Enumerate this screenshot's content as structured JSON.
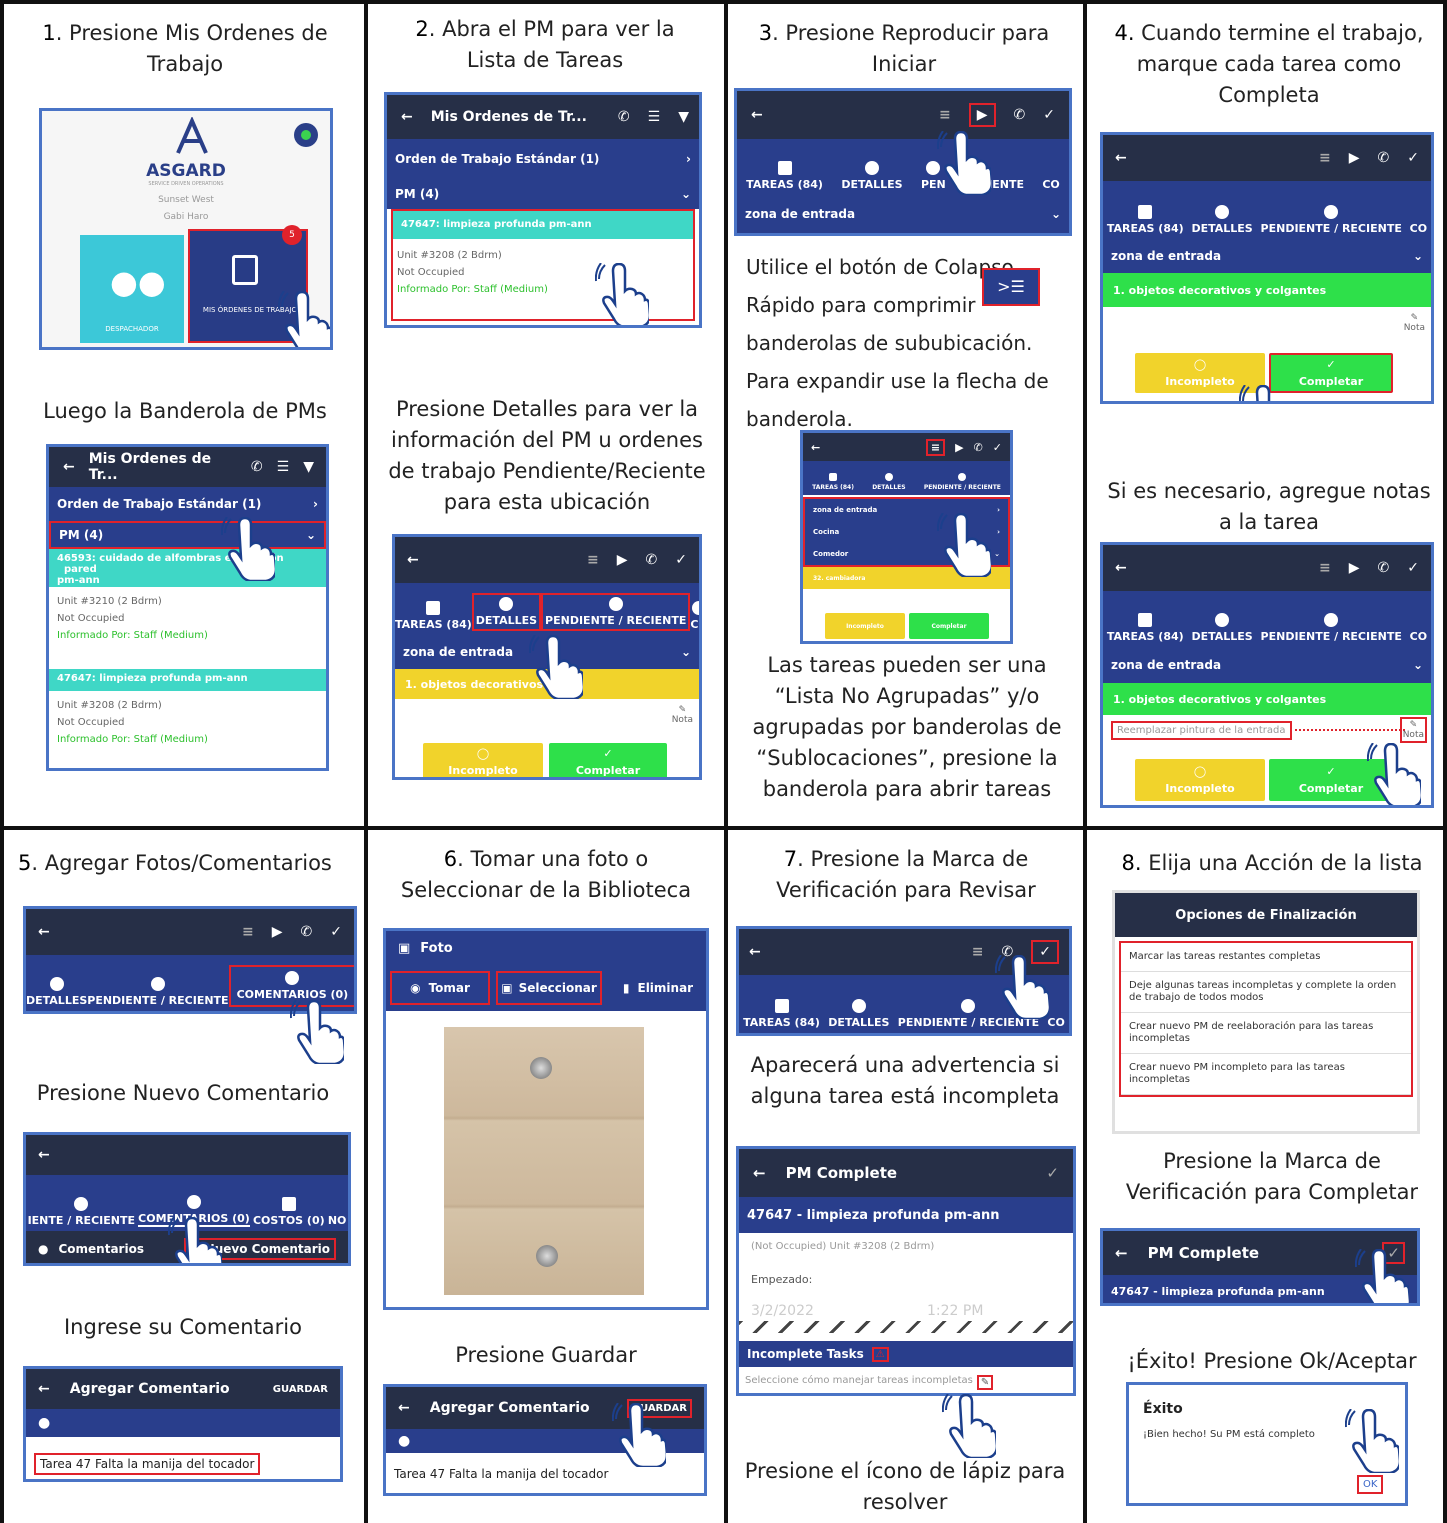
{
  "step1": {
    "num": "1",
    "text": ". Presione Mis Ordenes de Trabajo",
    "sub": "Luego la Banderola de PMs",
    "logo": "ASGARD",
    "logo_sub": "SERVICE DRIVEN OPERATIONS",
    "location": "Sunset West",
    "user": "Gabi Haro",
    "dispatcher": "DESPACHADOR",
    "my_orders": "MIS ÓRDENES DE TRABAJO",
    "badge": "5"
  },
  "list": {
    "title": "Mis Ordenes de Tr...",
    "std": "Orden de Trabajo Estándar (1)",
    "pm": "PM (4)",
    "wo1": "46593: cuidado de alfombras extracción",
    "wo1b": "pared",
    "wo1c": "pm-ann",
    "unit1": "Unit #3210 (2 Bdrm)",
    "occ": "Not Occupied",
    "informed": "Informado Por: Staff  (Medium)",
    "wo2": "47647: limpieza profunda pm-ann",
    "unit2": "Unit #3208 (2 Bdrm)"
  },
  "step2": {
    "num": "2",
    "text": ". Abra el PM para ver la Lista de Tareas",
    "sub": "Presione Detalles para ver la información del PM u ordenes de trabajo Pendiente/Reciente para esta ubicación"
  },
  "tabs": {
    "tareas": "TAREAS (84)",
    "detalles": "DETALLES",
    "pendiente": "PENDIENTE / RECIENTE",
    "co": "CO",
    "comentarios": "COMENTARIOS (0)",
    "costos": "COSTOS (0)",
    "pend_short": "IENTE / RECIENTE",
    "no": "NO",
    "pen": "PEN",
    "reciente": "RECIENTE"
  },
  "task": {
    "zona": "zona de entrada",
    "obj": "1. objetos decorativos y colgantes",
    "obj_short": "1. objetos decorativos y co",
    "nota": "Nota",
    "incomp": "Incompleto",
    "comp": "Completar",
    "cocina": "Cocina",
    "comedor": "Comedor",
    "cambiadora": "32. cambiadora",
    "reemplazar": "Reemplazar pintura de la entrada"
  },
  "step3": {
    "num": "3",
    "text": ". Presione Reproducir para Iniciar",
    "collapse": "Utilice el botón de Colapso Rápido para comprimir banderolas de sububicación. Para expandir use la flecha de banderola.",
    "collapse_icon": ">☰",
    "sub": "Las tareas pueden ser una “Lista No Agrupadas” y/o agrupadas por banderolas de “Sublocaciones”, presione la banderola para abrir tareas"
  },
  "step4": {
    "num": "4.",
    "text": " Cuando termine el trabajo, marque cada tarea como Completa",
    "sub": "Si es necesario, agregue notas a la tarea"
  },
  "step5": {
    "num": "5",
    "text": ". Agregar Fotos/Comentarios",
    "sub1": "Presione Nuevo Comentario",
    "sub2": "Ingrese su Comentario",
    "comentarios": "Comentarios",
    "nuevo": "Nuevo Comentario",
    "agregar": "Agregar Comentario",
    "guardar": "GUARDAR",
    "comment": "Tarea 47 Falta la manija del tocador"
  },
  "step6": {
    "num": "6",
    "text": ". Tomar una foto o Seleccionar de la Biblioteca",
    "sub": "Presione Guardar",
    "foto": "Foto",
    "tomar": "Tomar",
    "seleccionar": "Seleccionar",
    "eliminar": "Eliminar"
  },
  "step7": {
    "num": "7",
    "text": ". Presione la Marca de Verificación para Revisar",
    "sub1": "Aparecerá una advertencia si alguna tarea está incompleta",
    "sub2": "Presione el ícono de lápiz para resolver",
    "pmc": "PM Complete",
    "pmname": "47647 - limpieza profunda pm-ann",
    "unitline": "(Not Occupied) Unit #3208 (2 Bdrm)",
    "empezado": "Empezado:",
    "date": "3/2/2022",
    "time": "1:22 PM",
    "incomplete": "Incomplete Tasks",
    "select": "Seleccione cómo manejar tareas incompletas"
  },
  "step8": {
    "num": "8.",
    "text": " Elija una Acción de la lista",
    "opts_title": "Opciones de Finalización",
    "opts": [
      "Marcar las tareas restantes completas",
      "Deje algunas tareas incompletas y complete la orden de trabajo de todos modos",
      "Crear nuevo PM de reelaboración para las tareas incompletas",
      "Crear nuevo PM incompleto para las tareas incompletas"
    ],
    "sub1": "Presione la Marca de Verificación para Completar",
    "sub2": "¡Éxito! Presione Ok/Aceptar",
    "exito": "Éxito",
    "bien": "¡Bien hecho! Su PM está completo",
    "ok": "OK"
  }
}
